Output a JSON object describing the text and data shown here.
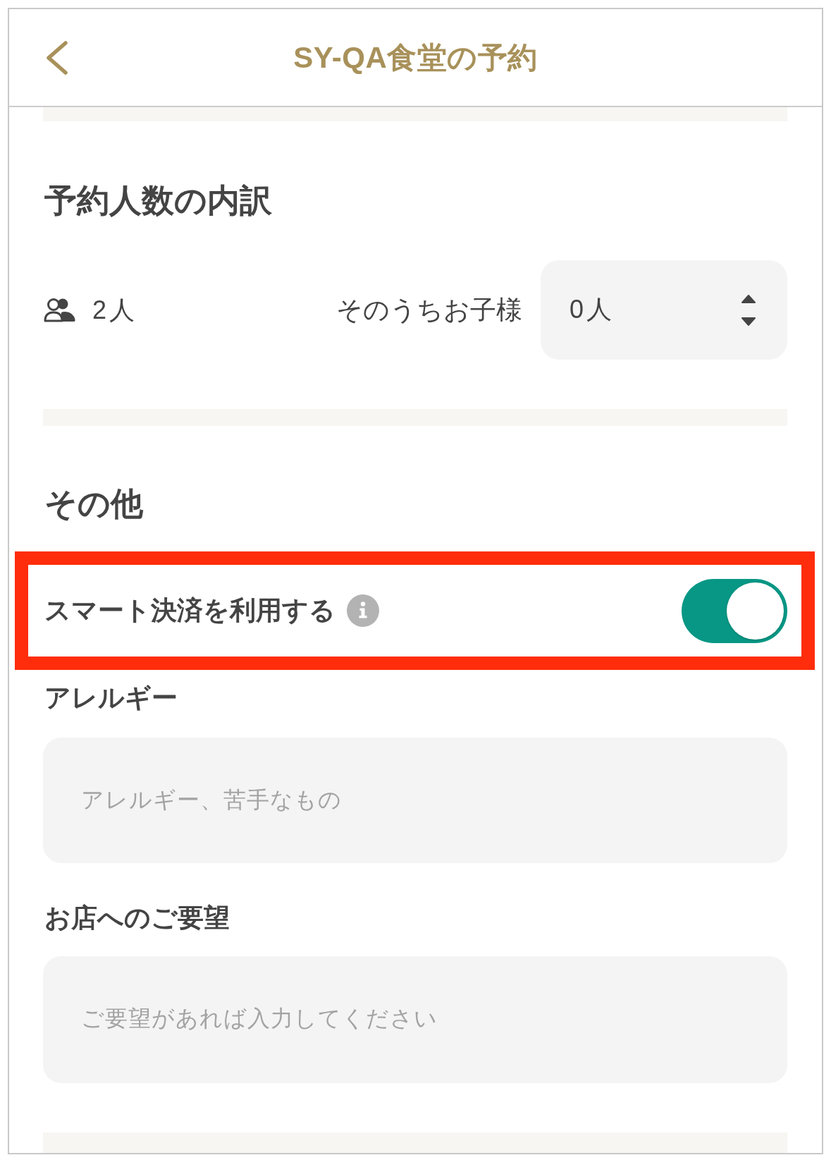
{
  "header": {
    "title": "SY-QA食堂の予約"
  },
  "party_breakdown": {
    "heading": "予約人数の内訳",
    "total": "2人",
    "children_label": "そのうちお子様",
    "children_select": {
      "value": "0人"
    }
  },
  "other": {
    "heading": "その他",
    "options": [
      {
        "kind": "toggle",
        "label": "スマート決済を利用する",
        "on": true,
        "highlighted": true
      }
    ],
    "fields": [
      {
        "label": "アレルギー",
        "placeholder": "アレルギー、苦手なもの"
      },
      {
        "label": "お店へのご要望",
        "placeholder": "ご要望があれば入力してください"
      }
    ]
  }
}
